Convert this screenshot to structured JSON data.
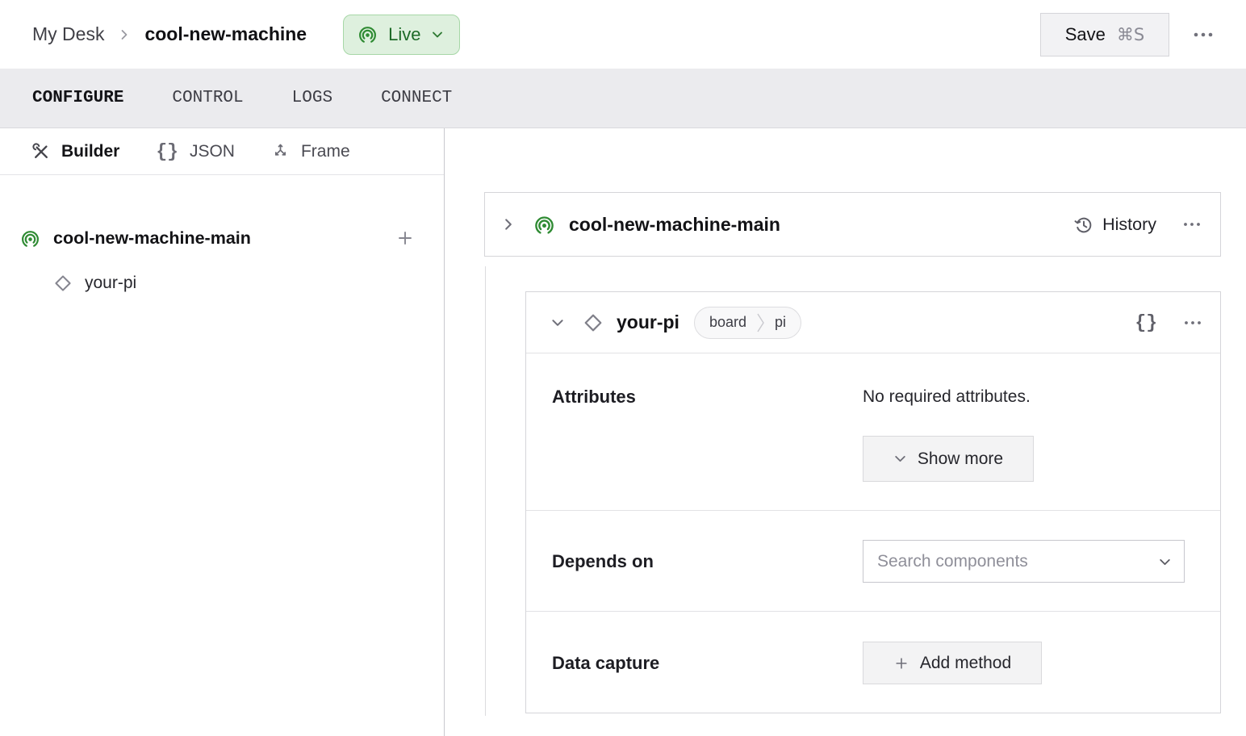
{
  "header": {
    "breadcrumb": {
      "parent": "My Desk",
      "current": "cool-new-machine"
    },
    "status": {
      "label": "Live",
      "icon": "broadcast-icon"
    },
    "save": {
      "label": "Save",
      "shortcut": "⌘S"
    }
  },
  "tabs": [
    {
      "label": "CONFIGURE",
      "active": true
    },
    {
      "label": "CONTROL",
      "active": false
    },
    {
      "label": "LOGS",
      "active": false
    },
    {
      "label": "CONNECT",
      "active": false
    }
  ],
  "sidebar": {
    "modes": [
      {
        "label": "Builder",
        "icon": "tools-icon",
        "active": true
      },
      {
        "label": "JSON",
        "icon": "braces-icon",
        "active": false
      },
      {
        "label": "Frame",
        "icon": "frame-axes-icon",
        "active": false
      }
    ],
    "tree": {
      "machine": {
        "label": "cool-new-machine-main",
        "icon": "broadcast-icon"
      },
      "component": {
        "label": "your-pi",
        "icon": "diamond-icon"
      }
    }
  },
  "main": {
    "machine_card": {
      "title": "cool-new-machine-main",
      "history_label": "History"
    },
    "component_card": {
      "title": "your-pi",
      "type_badge": {
        "type": "board",
        "model": "pi"
      },
      "attributes": {
        "label": "Attributes",
        "empty_text": "No required attributes.",
        "show_more_label": "Show more"
      },
      "depends_on": {
        "label": "Depends on",
        "placeholder": "Search components"
      },
      "data_capture": {
        "label": "Data capture",
        "add_method_label": "Add method"
      }
    }
  },
  "icons": {
    "braces_glyph": "{}"
  },
  "colors": {
    "accent_green": "#2f8b33",
    "live_bg": "#def0de",
    "live_border": "#a7d7a7",
    "live_text": "#1d6b28",
    "tabbar_bg": "#ebebee",
    "card_border": "#d5d5d9",
    "button_bg": "#f3f3f4"
  }
}
